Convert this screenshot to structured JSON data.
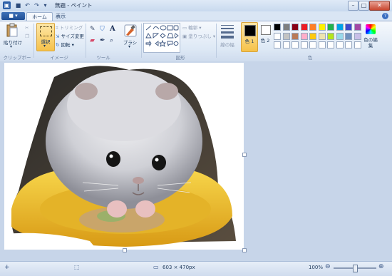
{
  "window": {
    "title": "無題 - ペイント",
    "controls": {
      "minimize": "–",
      "maximize": "□",
      "close": "✕"
    }
  },
  "quick_access": {
    "save": "■",
    "undo": "↶",
    "redo": "↷",
    "more": "▾"
  },
  "tabs": {
    "file_menu": "■ ▾",
    "items": [
      {
        "label": "ホーム",
        "active": true
      },
      {
        "label": "表示",
        "active": false
      }
    ]
  },
  "ribbon": {
    "clipboard": {
      "paste": "貼り付け",
      "group": "クリップボード"
    },
    "image": {
      "select": "選択",
      "crop": "トリミング",
      "resize": "サイズ変更",
      "rotate": "回転",
      "group": "イメージ"
    },
    "tools": {
      "group": "ツール"
    },
    "brushes": {
      "label": "ブラシ"
    },
    "shapes": {
      "outline": "輪郭",
      "fill": "塗りつぶし",
      "group": "図形"
    },
    "size": {
      "label": "線の幅"
    },
    "colors": {
      "color1": "色 1",
      "color2": "色 2",
      "edit": "色の編集",
      "group": "色",
      "color1_value": "#000000",
      "color2_value": "#ffffff",
      "palette_row1": [
        "#000000",
        "#7f7f7f",
        "#880015",
        "#ed1c24",
        "#ff7f27",
        "#fff200",
        "#22b14c",
        "#00a2e8",
        "#3f48cc",
        "#a349a4"
      ],
      "palette_row2": [
        "#ffffff",
        "#c3c3c3",
        "#b97a57",
        "#ffaec9",
        "#ffc90e",
        "#efe4b0",
        "#b5e61d",
        "#99d9ea",
        "#7092be",
        "#c8bfe7"
      ]
    }
  },
  "statusbar": {
    "dimensions": "603 × 470px",
    "zoom": "100%",
    "zoom_out": "⊖",
    "zoom_in": "⊕"
  }
}
